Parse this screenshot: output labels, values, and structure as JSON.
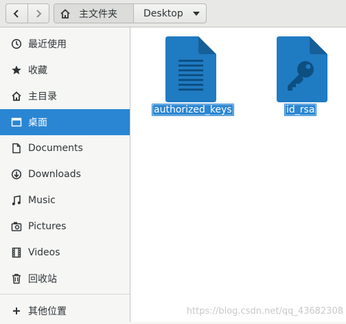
{
  "toolbar": {
    "back_icon": "chevron-left-icon",
    "forward_icon": "chevron-right-icon"
  },
  "pathbar": {
    "home_label": "主文件夹",
    "current_label": "Desktop",
    "dropdown_icon": "triangle-down-icon"
  },
  "sidebar": {
    "items": [
      {
        "label": "最近使用",
        "icon": "clock-icon",
        "active": false
      },
      {
        "label": "收藏",
        "icon": "star-icon",
        "active": false
      },
      {
        "label": "主目录",
        "icon": "home-icon",
        "active": false
      },
      {
        "label": "桌面",
        "icon": "folder-icon",
        "active": true
      },
      {
        "label": "Documents",
        "icon": "document-icon",
        "active": false
      },
      {
        "label": "Downloads",
        "icon": "download-icon",
        "active": false
      },
      {
        "label": "Music",
        "icon": "music-icon",
        "active": false
      },
      {
        "label": "Pictures",
        "icon": "camera-icon",
        "active": false
      },
      {
        "label": "Videos",
        "icon": "film-icon",
        "active": false
      },
      {
        "label": "回收站",
        "icon": "trash-icon",
        "active": false
      }
    ],
    "other_locations": {
      "label": "其他位置",
      "icon": "plus-icon"
    }
  },
  "files": [
    {
      "name": "authorized_keys",
      "icon": "text-document-icon",
      "selected": true
    },
    {
      "name": "id_rsa",
      "icon": "key-document-icon",
      "selected": true
    }
  ],
  "watermark": "https://blog.csdn.net/qq_43682308",
  "colors": {
    "accent": "#2a86d3",
    "file_icon": "#1f7bc2",
    "file_icon_fold": "#165f99"
  }
}
